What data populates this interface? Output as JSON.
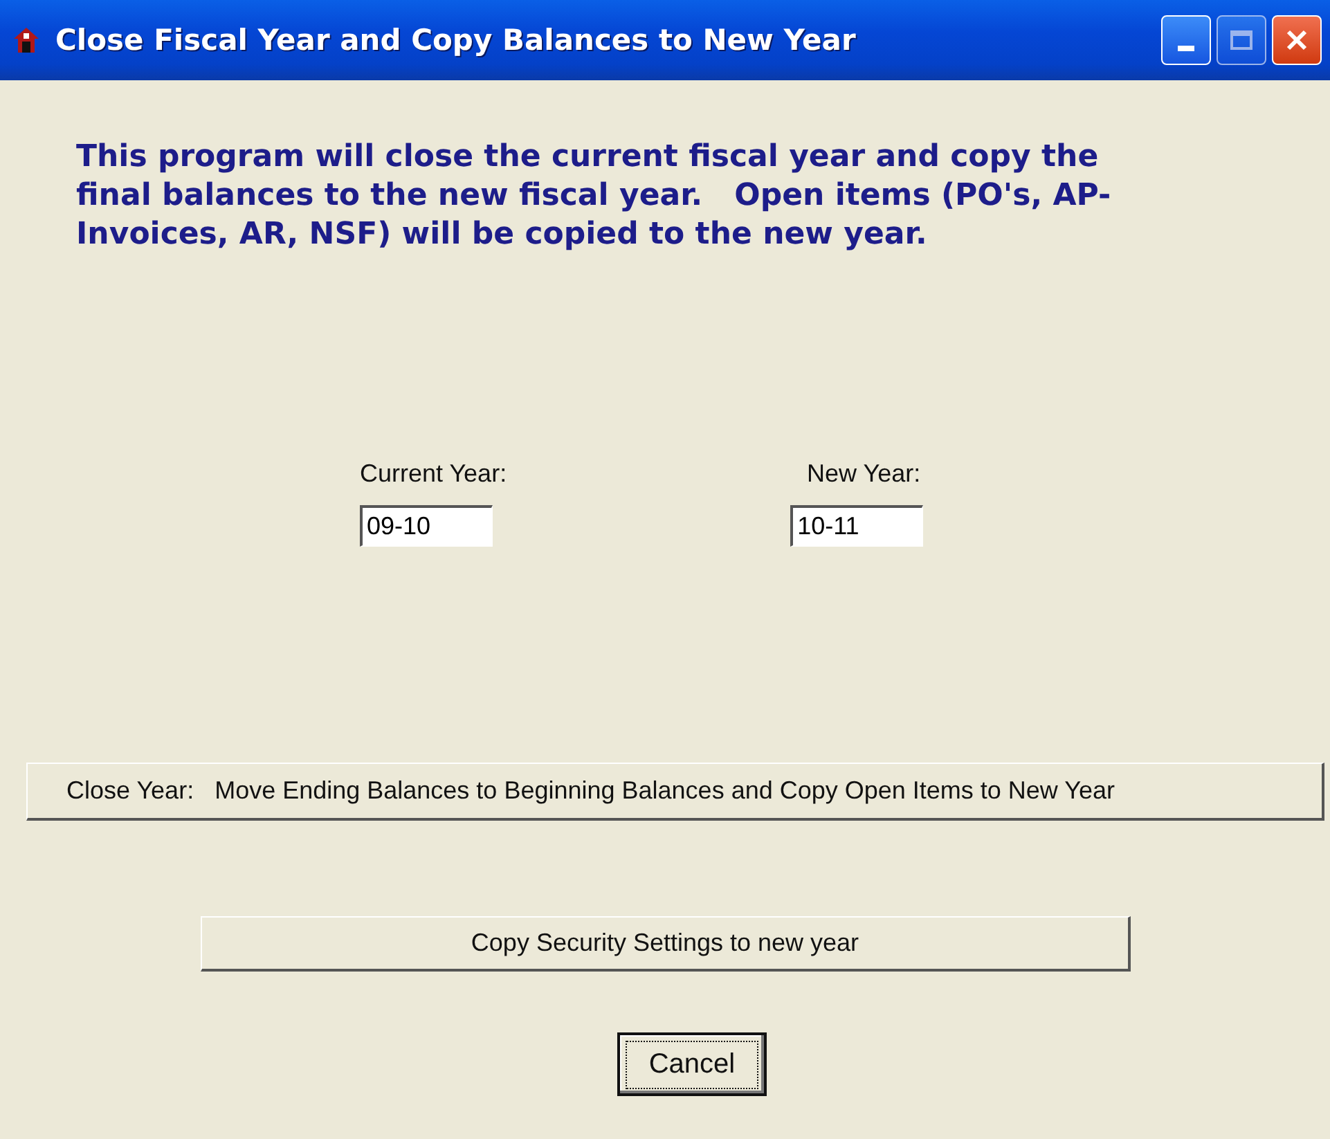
{
  "window": {
    "title": "Close Fiscal Year and Copy Balances to New Year"
  },
  "intro": "This program will close the current fiscal year and copy the final balances to the new fiscal year.   Open items (PO's, AP-Invoices, AR, NSF) will be copied to the new year.",
  "fields": [
    {
      "label": "Current Year:",
      "value": "09-10"
    },
    {
      "label": "New Year:",
      "value": "10-11"
    }
  ],
  "buttons": [
    {
      "kind": "wide",
      "label": "Close Year:   Move Ending Balances to Beginning Balances and Copy Open Items to New Year"
    },
    {
      "kind": "medium",
      "label": "Copy Security Settings to new year"
    },
    {
      "kind": "default",
      "label": "Cancel"
    }
  ]
}
